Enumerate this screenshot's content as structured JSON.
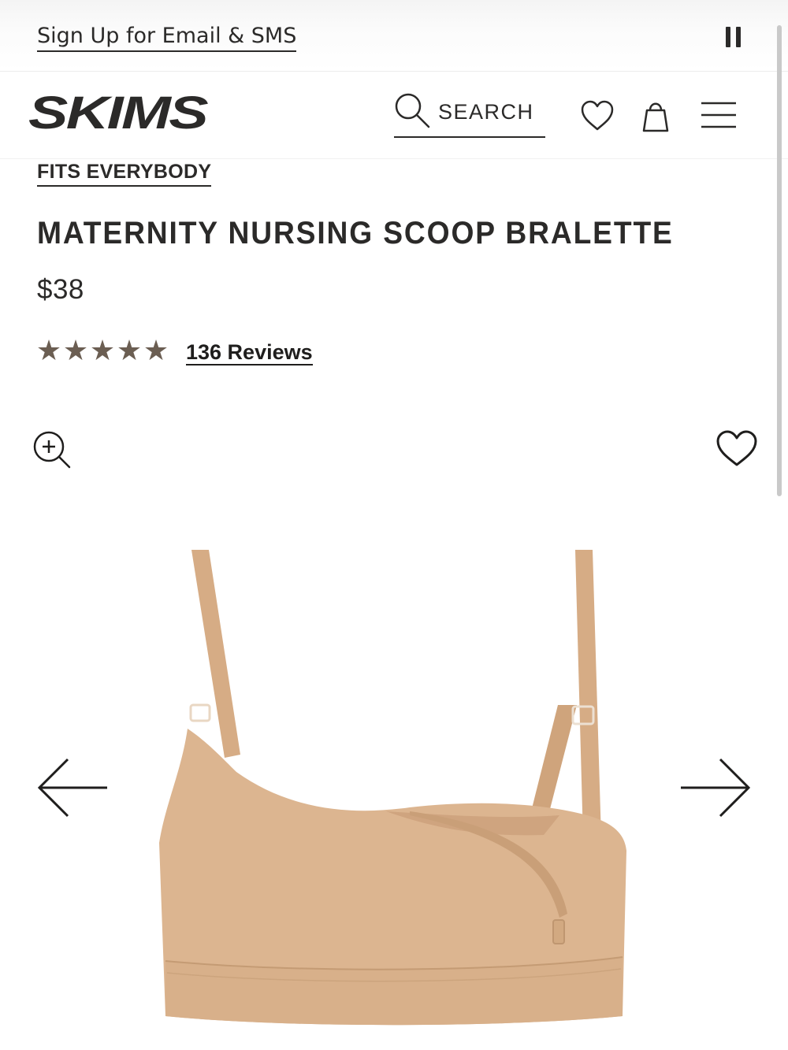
{
  "promo": {
    "signup_label": "Sign Up for Email & SMS"
  },
  "header": {
    "logo_text": "SKIMS",
    "search_label": "SEARCH",
    "icons": [
      "search-icon",
      "heart-icon",
      "bag-icon",
      "menu-icon"
    ]
  },
  "product": {
    "collection": "FITS EVERYBODY",
    "title": "MATERNITY NURSING SCOOP BRALETTE",
    "price": "$38",
    "rating": 5,
    "rating_max": 5,
    "reviews_label": "136 Reviews",
    "image_color": "#dcb590"
  },
  "gallery": {
    "icons": [
      "zoom-in-icon",
      "heart-icon",
      "arrow-left-icon",
      "arrow-right-icon"
    ]
  },
  "colors": {
    "text": "#2b2a29",
    "star": "#6b5e52"
  }
}
